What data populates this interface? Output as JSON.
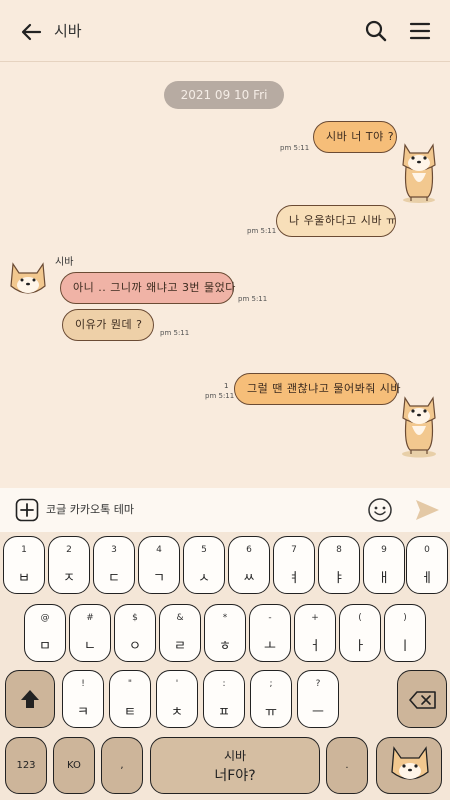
{
  "header": {
    "title": "시바",
    "back_icon": "arrow-left-icon",
    "search_icon": "search-icon",
    "menu_icon": "hamburger-menu-icon"
  },
  "date_separator": "2021 09 10 Fri",
  "messages": [
    {
      "text": "시바 너 T야 ?",
      "time": "pm 5:11"
    },
    {
      "text": "나 우울하다고 시바 ㅠ",
      "time": "pm 5:11"
    },
    {
      "sender": "시바",
      "text": "아니 .. 그니까 왜냐고 3번 물었다",
      "time": "pm 5:11"
    },
    {
      "text": "이유가 뭔데 ?",
      "time": "pm 5:11"
    },
    {
      "text": "그럴 땐 괜찮냐고 물어봐줘 시바",
      "time": "pm 5:11",
      "unread": "1"
    }
  ],
  "input": {
    "text": "코글 카카오톡 테마"
  },
  "keyboard": {
    "row1": [
      {
        "top": "1",
        "main": "ㅂ"
      },
      {
        "top": "2",
        "main": "ㅈ"
      },
      {
        "top": "3",
        "main": "ㄷ"
      },
      {
        "top": "4",
        "main": "ㄱ"
      },
      {
        "top": "5",
        "main": "ㅅ"
      },
      {
        "top": "6",
        "main": "ㅆ"
      },
      {
        "top": "7",
        "main": "ㅕ"
      },
      {
        "top": "8",
        "main": "ㅑ"
      },
      {
        "top": "9",
        "main": "ㅐ"
      },
      {
        "top": "0",
        "main": "ㅔ"
      }
    ],
    "row2": [
      {
        "top": "@",
        "main": "ㅁ"
      },
      {
        "top": "#",
        "main": "ㄴ"
      },
      {
        "top": "$",
        "main": "ㅇ"
      },
      {
        "top": "&",
        "main": "ㄹ"
      },
      {
        "top": "*",
        "main": "ㅎ"
      },
      {
        "top": "-",
        "main": "ㅗ"
      },
      {
        "top": "+",
        "main": "ㅓ"
      },
      {
        "top": "(",
        "main": "ㅏ"
      },
      {
        "top": ")",
        "main": "ㅣ"
      }
    ],
    "row3": [
      {
        "top": "!",
        "main": "ㅋ"
      },
      {
        "top": "\"",
        "main": "ㅌ"
      },
      {
        "top": "'",
        "main": "ㅊ"
      },
      {
        "top": ":",
        "main": "ㅍ"
      },
      {
        "top": ";",
        "main": "ㅠ"
      },
      {
        "top": "?",
        "main": "ㅡ"
      }
    ],
    "sym_key": "123",
    "lang_key": "KO",
    "comma_key": ",",
    "space_line1": "시바",
    "space_line2": "너F야?",
    "period_key": "."
  }
}
